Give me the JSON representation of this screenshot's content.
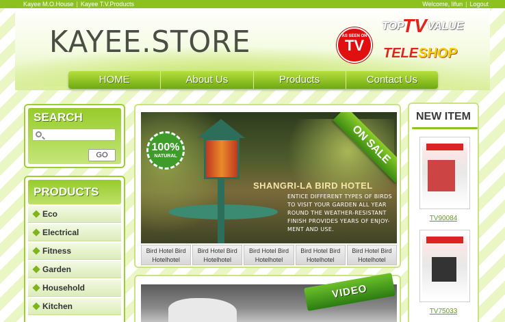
{
  "topbar": {
    "left_links": [
      "Kayee M.O.House",
      "Kayee T.V.Products"
    ],
    "welcome": "Welcome, lifun",
    "logout": "Logout"
  },
  "header": {
    "logo": "KAYEE.STORE",
    "as_seen_on_small": "AS SEEN ON",
    "as_seen_on_tv": "TV",
    "top_value_top": "TOP",
    "top_value_tv": "TV",
    "top_value_value": "VALUE",
    "teleshop_tele": "TELE",
    "teleshop_shop": "SHOP"
  },
  "nav": {
    "items": [
      "HOME",
      "About Us",
      "Products",
      "Contact Us"
    ]
  },
  "search": {
    "title": "SEARCH",
    "placeholder": "",
    "button": "GO"
  },
  "products_menu": {
    "title": "PRODUCTS",
    "items": [
      "Eco",
      "Electrical",
      "Fitness",
      "Garden",
      "Household",
      "Kitchen"
    ]
  },
  "banner": {
    "badge_top": "100%",
    "badge_bottom": "NATURAL",
    "on_sale": "ON SALE",
    "title": "SHANGRI-LA BIRD HOTEL",
    "description": "ENTICE DIFFERENT TYPES OF BIRDS TO VISIT YOUR GARDEN ALL YEAR ROUND THE WEATHER-RESISTANT FINISH PROVIDES YEARS OF ENJOY-MENT AND USE.",
    "thumbs": [
      "Bird Hotel Bird Hotelhotel",
      "Bird Hotel Bird Hotelhotel",
      "Bird Hotel Bird Hotelhotel",
      "Bird Hotel Bird Hotelhotel",
      "Bird Hotel Bird Hotelhotel"
    ]
  },
  "video": {
    "label": "VIDEO"
  },
  "new_item": {
    "title": "NEW ITEM",
    "products": [
      {
        "code": "TV90084"
      },
      {
        "code": "TV75033"
      }
    ]
  },
  "colors": {
    "accent": "#8cc21f",
    "nav_dark": "#6ea813",
    "sale_red": "#e2231a"
  }
}
